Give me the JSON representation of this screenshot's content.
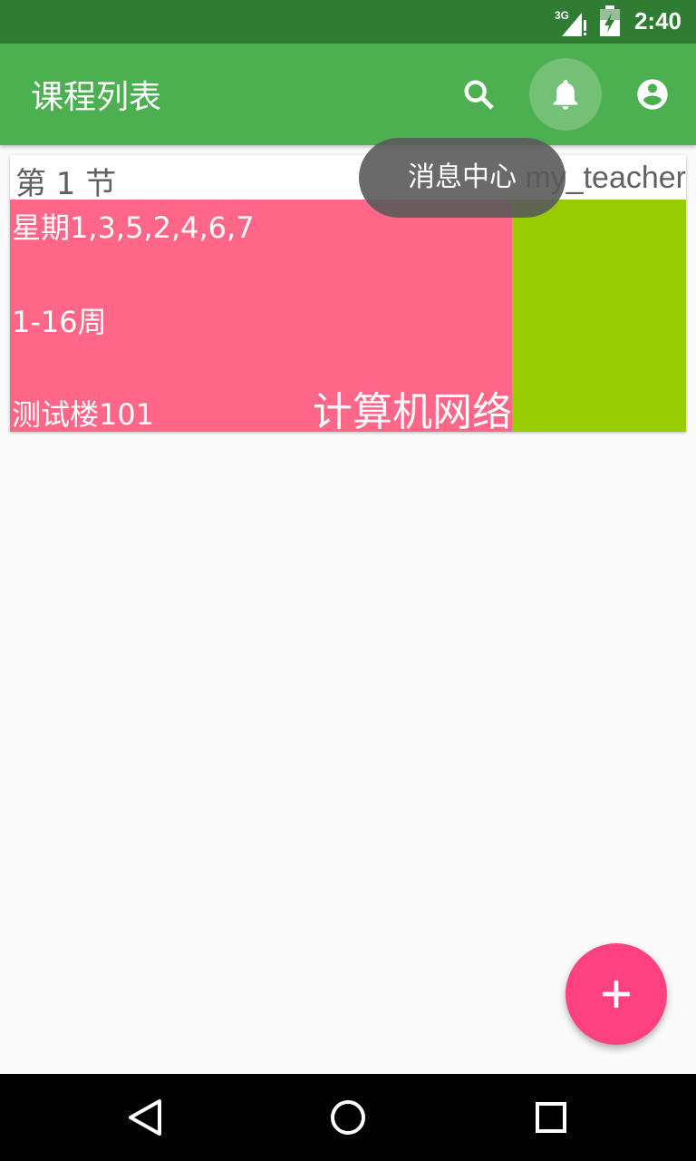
{
  "status_bar": {
    "network": "3G",
    "time": "2:40",
    "icons": [
      "signal-icon",
      "battery-icon"
    ]
  },
  "app_bar": {
    "title": "课程列表",
    "actions": [
      "search-icon",
      "bell-icon",
      "account-icon"
    ]
  },
  "tooltip": "消息中心",
  "course_card": {
    "section": "第 1 节",
    "teacher": "my_teacher",
    "days": "星期1,3,5,2,4,6,7",
    "weeks": "1-16周",
    "location": "测试楼101",
    "course_name": "计算机网络",
    "colors": {
      "course": "#ff6688",
      "secondary": "#99cc00"
    }
  },
  "fab": {
    "icon": "plus-icon",
    "color": "#ff4081"
  },
  "nav_bar": {
    "icons": [
      "back-icon",
      "home-icon",
      "recents-icon"
    ]
  },
  "colors": {
    "primary": "#4caf50",
    "primary_dark": "#2e7d32"
  }
}
